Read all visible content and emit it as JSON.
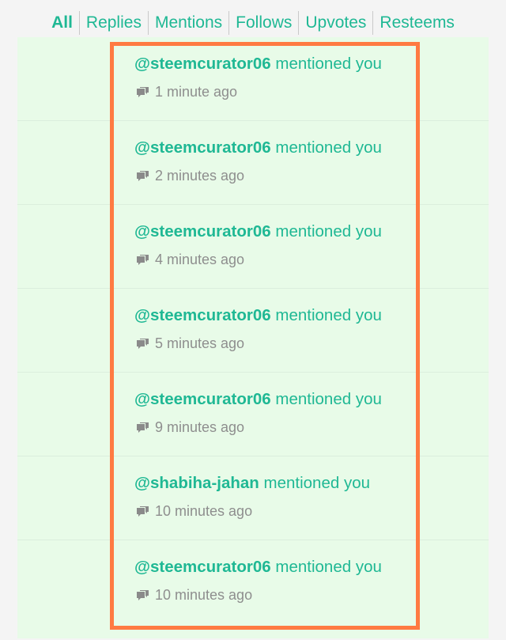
{
  "tabs": [
    "All",
    "Replies",
    "Mentions",
    "Follows",
    "Upvotes",
    "Resteems"
  ],
  "active_tab": "All",
  "colors": {
    "accent": "#1fb894",
    "highlight_border": "#ff7a42",
    "row_background": "#e8fbe8",
    "page_background": "#f4f4f4",
    "meta_text": "#8e8e8e"
  },
  "icons": {
    "notification_type": "comments-icon"
  },
  "notifications": [
    {
      "user": "@steemcurator06",
      "action": "mentioned you",
      "time": "1 minute ago"
    },
    {
      "user": "@steemcurator06",
      "action": "mentioned you",
      "time": "2 minutes ago"
    },
    {
      "user": "@steemcurator06",
      "action": "mentioned you",
      "time": "4 minutes ago"
    },
    {
      "user": "@steemcurator06",
      "action": "mentioned you",
      "time": "5 minutes ago"
    },
    {
      "user": "@steemcurator06",
      "action": "mentioned you",
      "time": "9 minutes ago"
    },
    {
      "user": "@shabiha-jahan",
      "action": "mentioned you",
      "time": "10 minutes ago"
    },
    {
      "user": "@steemcurator06",
      "action": "mentioned you",
      "time": "10 minutes ago"
    }
  ]
}
